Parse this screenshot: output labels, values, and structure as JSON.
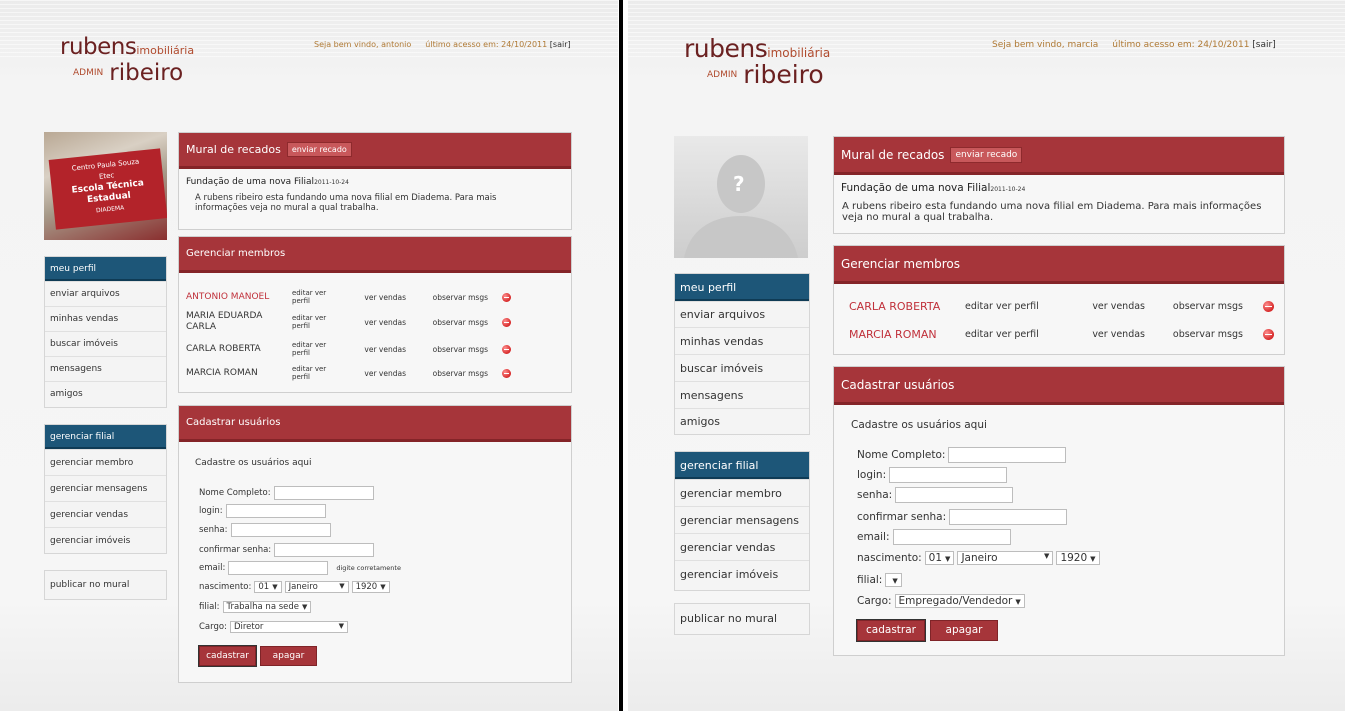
{
  "left": {
    "logo": {
      "rubens": "rubens",
      "imobiliaria": "imobiliária",
      "admin": "ADMIN",
      "ribeiro": "ribeiro"
    },
    "header": {
      "welcome": "Seja bem vindo, antonio",
      "last_access": "último acesso em: 24/10/2011",
      "logout": "[sair]"
    },
    "photo_sign": {
      "line1": "Centro Paula Souza",
      "line2": "Etec",
      "line3": "Escola Técnica Estadual",
      "line4": "DIADEMA"
    },
    "nav_main": {
      "header": "meu perfil",
      "items": [
        "enviar arquivos",
        "minhas vendas",
        "buscar imóveis",
        "mensagens",
        "amigos"
      ]
    },
    "nav_branch": {
      "header": "gerenciar filial",
      "items": [
        "gerenciar membro",
        "gerenciar mensagens",
        "gerenciar vendas",
        "gerenciar imóveis"
      ]
    },
    "nav_mural": {
      "item": "publicar no mural"
    },
    "mural": {
      "title": "Mural de recados",
      "send_label": "enviar recado",
      "news_title": "Fundação de uma nova Filial",
      "news_date": "2011-10-24",
      "news_body": "A rubens ribeiro esta fundando uma nova filial em Diadema. Para mais informações veja no mural a qual trabalha."
    },
    "members": {
      "title": "Gerenciar membros",
      "edit_label": "editar ver perfil",
      "sales_label": "ver vendas",
      "msgs_label": "observar msgs",
      "rows": [
        {
          "name": "ANTONIO MANOEL"
        },
        {
          "name": "MARIA EDUARDA CARLA"
        },
        {
          "name": "CARLA ROBERTA"
        },
        {
          "name": "MARCIA ROMAN"
        }
      ]
    },
    "register": {
      "title": "Cadastrar usuários",
      "intro": "Cadastre os usuários aqui",
      "name_label": "Nome Completo:",
      "login_label": "login:",
      "password_label": "senha:",
      "confirm_label": "confirmar senha:",
      "email_label": "email:",
      "email_hint": "digite corretamente",
      "birth_label": "nascimento:",
      "day": "01",
      "month": "Janeiro",
      "year": "1920",
      "branch_label": "filial:",
      "branch_value": "Trabalha na sede",
      "role_label": "Cargo:",
      "role_value": "Diretor",
      "submit_label": "cadastrar",
      "clear_label": "apagar"
    }
  },
  "right": {
    "logo": {
      "rubens": "rubens",
      "imobiliaria": "imobiliária",
      "admin": "ADMIN",
      "ribeiro": "ribeiro"
    },
    "header": {
      "welcome": "Seja bem vindo, marcia",
      "last_access": "último acesso em: 24/10/2011",
      "logout": "[sair]"
    },
    "photo_placeholder": "?",
    "nav_main": {
      "header": "meu perfil",
      "items": [
        "enviar arquivos",
        "minhas vendas",
        "buscar imóveis",
        "mensagens",
        "amigos"
      ]
    },
    "nav_branch": {
      "header": "gerenciar filial",
      "items": [
        "gerenciar membro",
        "gerenciar mensagens",
        "gerenciar vendas",
        "gerenciar imóveis"
      ]
    },
    "nav_mural": {
      "item": "publicar no mural"
    },
    "mural": {
      "title": "Mural de recados",
      "send_label": "enviar recado",
      "news_title": "Fundação de uma nova Filial",
      "news_date": "2011-10-24",
      "news_body": "A rubens ribeiro esta fundando uma nova filial em Diadema. Para mais informações veja no mural a qual trabalha."
    },
    "members": {
      "title": "Gerenciar membros",
      "edit_label": "editar ver perfil",
      "sales_label": "ver vendas",
      "msgs_label": "observar msgs",
      "rows": [
        {
          "name": "CARLA ROBERTA"
        },
        {
          "name": "MARCIA ROMAN"
        }
      ]
    },
    "register": {
      "title": "Cadastrar usuários",
      "intro": "Cadastre os usuários aqui",
      "name_label": "Nome Completo:",
      "login_label": "login:",
      "password_label": "senha:",
      "confirm_label": "confirmar senha:",
      "email_label": "email:",
      "birth_label": "nascimento:",
      "day": "01",
      "month": "Janeiro",
      "year": "1920",
      "branch_label": "filial:",
      "branch_value": "",
      "role_label": "Cargo:",
      "role_value": "Empregado/Vendedor",
      "submit_label": "cadastrar",
      "clear_label": "apagar"
    }
  },
  "colors": {
    "header_red": "#a6353a",
    "nav_blue": "#1d5678",
    "member_name_red": "#c0303a",
    "welcome_orange": "#b07a35"
  }
}
